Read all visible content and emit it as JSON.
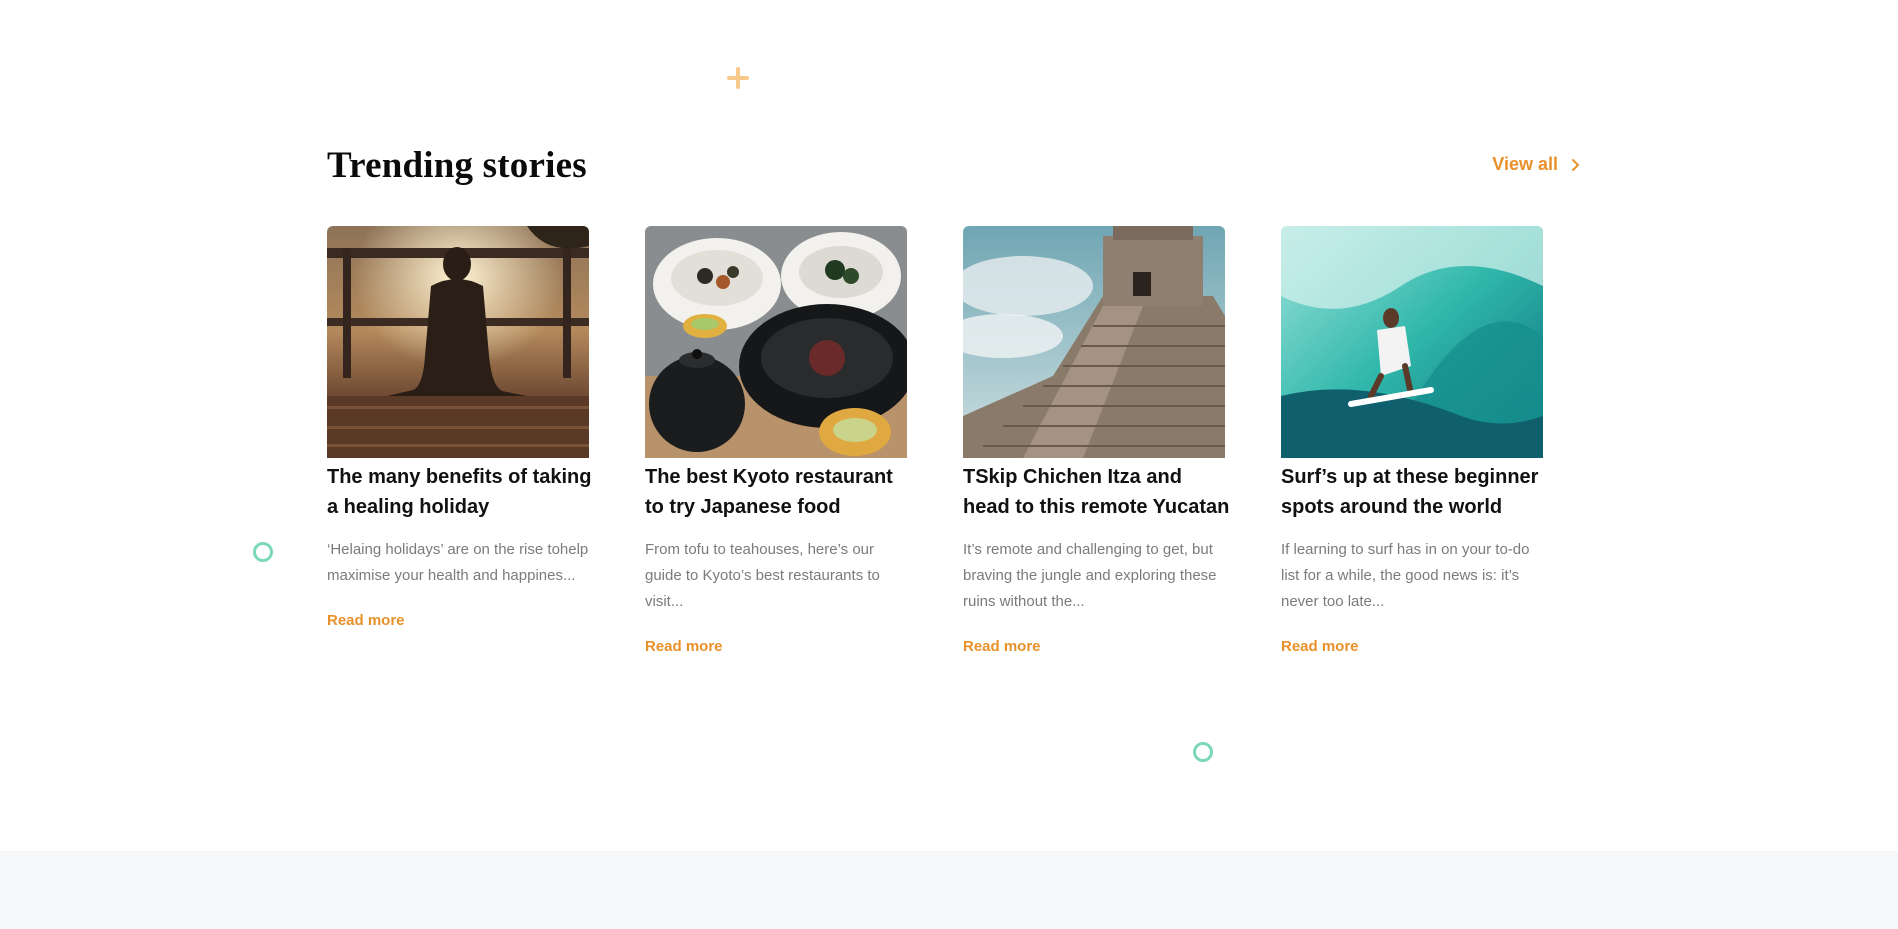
{
  "section": {
    "title": "Trending stories",
    "view_all_label": "View all"
  },
  "colors": {
    "accent": "#e8912a",
    "decor_plus": "#f9c98b",
    "decor_ring": "#7dd8bb",
    "footer_bg": "#f7f8fa"
  },
  "cards": [
    {
      "image": "meditation-sunset-photo",
      "title": "The many benefits of taking a healing holiday",
      "description": "‘Helaing holidays’ are on the rise tohelp maximise your health and happines...",
      "link": "Read more"
    },
    {
      "image": "japanese-food-bowls-photo",
      "title": "The best Kyoto restaurant to try Japanese food",
      "description": "From tofu to teahouses, here’s our guide to Kyoto’s best restaurants to visit...",
      "link": "Read more"
    },
    {
      "image": "chichen-itza-pyramid-photo",
      "title": "TSkip Chichen Itza and head to this remote Yucatan",
      "description": "It’s remote and challenging to get, but braving the jungle and exploring these ruins without the...",
      "link": "Read more"
    },
    {
      "image": "surfer-wave-photo",
      "title": "Surf’s up at these beginner spots around the world",
      "description": "If learning to surf has in on your to-do list for a while, the good news is: it’s never too late...",
      "link": "Read more"
    }
  ]
}
